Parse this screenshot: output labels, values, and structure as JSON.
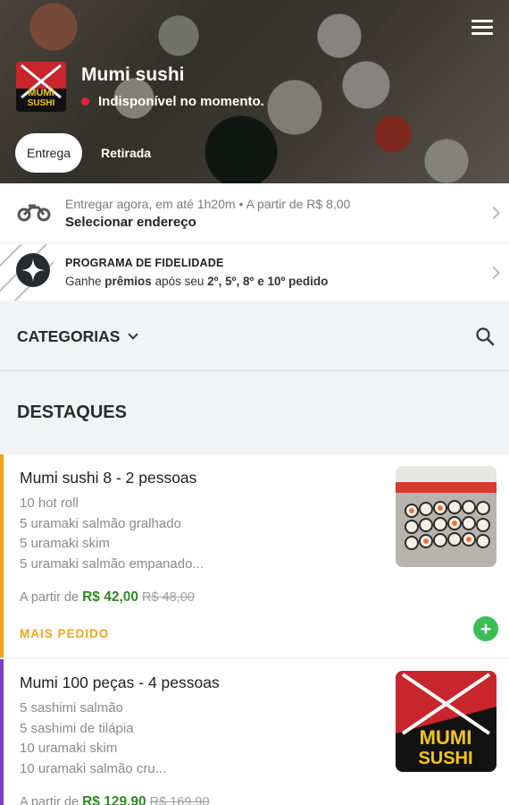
{
  "store": {
    "name": "Mumi sushi",
    "status": "Indisponível no momento.",
    "status_color": "#e0243e",
    "tabs": [
      "Entrega",
      "Retirada"
    ],
    "active_tab": "Entrega"
  },
  "delivery": {
    "info": "Entregar agora, em até 1h20m  •  A partir de R$ 8,00",
    "action": "Selecionar endereço",
    "icon": "motorcycle-icon"
  },
  "loyalty": {
    "title": "PROGRAMA DE FIDELIDADE",
    "prefix": "Ganhe ",
    "bold1": "prêmios",
    "middle": " após seu ",
    "bold2": "2º, 5º, 8º e 10º pedido",
    "icon": "sparkle-icon"
  },
  "categories": {
    "label": "CATEGORIAS"
  },
  "section": {
    "title": "DESTAQUES"
  },
  "products": [
    {
      "name": "Mumi sushi 8 - 2 pessoas",
      "items": [
        "10 hot roll",
        "5 uramaki salmão gralhado",
        "5 uramaki skim",
        "5 uramaki salmão empanado..."
      ],
      "price_prefix": "A partir de",
      "price": "R$ 42,00",
      "old_price": "R$ 48,00",
      "badge": "MAIS PEDIDO",
      "accent": "#f0a51c"
    },
    {
      "name": "Mumi 100 peças - 4 pessoas",
      "items": [
        "5 sashimi salmão",
        "5 sashimi de tilápia",
        "10 uramaki skim",
        "10 uramaki salmão cru..."
      ],
      "price_prefix": "A partir de",
      "price": "R$ 129,90",
      "old_price": "R$ 169,90",
      "accent": "#7f3fc9",
      "logo_text": [
        "MUMI",
        "SUSHI"
      ]
    }
  ],
  "logo_text": [
    "MUMI",
    "SUSHI"
  ],
  "colors": {
    "price_green": "#2e8b22",
    "add_button": "#3bbf55"
  }
}
